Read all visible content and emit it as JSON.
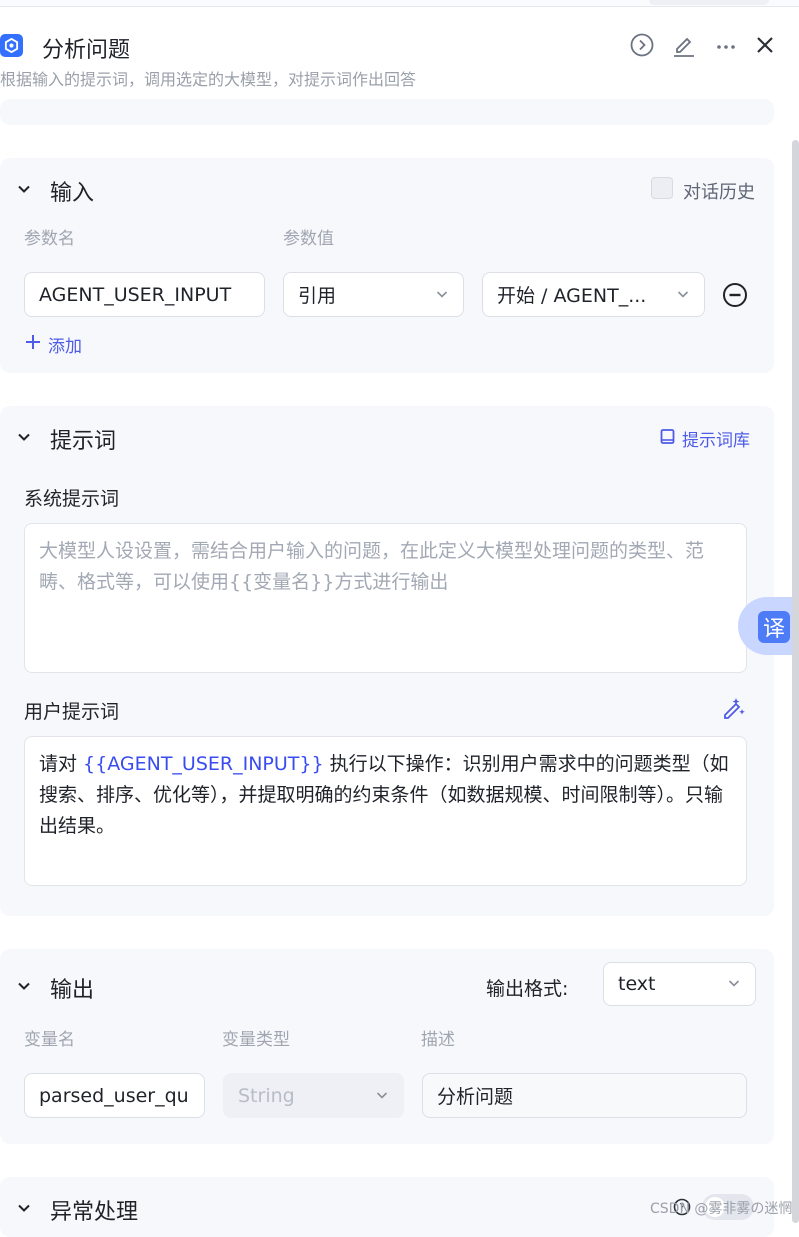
{
  "header": {
    "title": "分析问题",
    "subtitle": "根据输入的提示词，调用选定的大模型，对提示词作出回答",
    "icons": [
      "run-icon",
      "edit-icon",
      "more-icon",
      "close-icon"
    ]
  },
  "input": {
    "title": "输入",
    "history_label": "对话历史",
    "history_checked": false,
    "col_name": "参数名",
    "col_value": "参数值",
    "param_name": "AGENT_USER_INPUT",
    "ref_type": "引用",
    "ref_value": "开始 / AGENT_...",
    "add_label": "添加"
  },
  "prompt": {
    "title": "提示词",
    "library_label": "提示词库",
    "system_label": "系统提示词",
    "system_placeholder": "大模型人设设置，需结合用户输入的问题，在此定义大模型处理问题的类型、范畴、格式等，可以使用{{变量名}}方式进行输出",
    "user_label": "用户提示词",
    "user_prefix": "请对 ",
    "user_var": "{{AGENT_USER_INPUT}}",
    "user_suffix": " 执行以下操作：识别用户需求中的问题类型（如搜索、排序、优化等），并提取明确的约束条件（如数据规模、时间限制等）。只输出结果。"
  },
  "output": {
    "title": "输出",
    "format_label": "输出格式:",
    "format_value": "text",
    "col_var": "变量名",
    "col_type": "变量类型",
    "col_desc": "描述",
    "var_name": "parsed_user_qu",
    "var_type": "String",
    "var_desc": "分析问题"
  },
  "exception": {
    "title": "异常处理"
  },
  "translate_label": "译",
  "watermark": "CSDN @雾非雾の迷惘",
  "colors": {
    "accent": "#3370ff",
    "link": "#4e5be6",
    "variable": "#3a4cf0",
    "card_bg": "#f7f8fc"
  }
}
